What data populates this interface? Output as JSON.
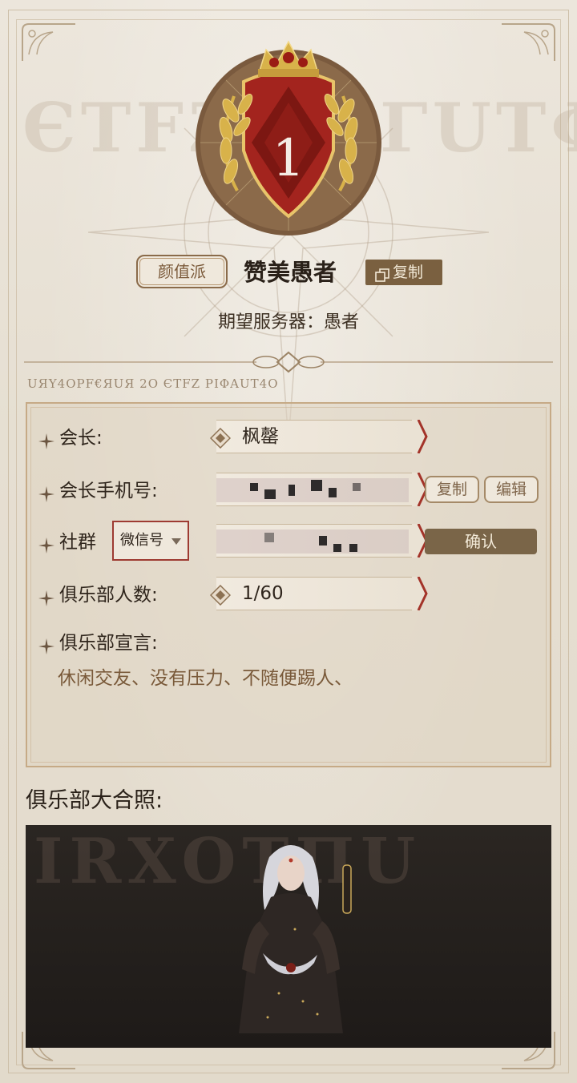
{
  "header": {
    "rank": "1",
    "tag": "颜值派",
    "club_name": "赞美愚者",
    "copy_label": "复制",
    "server_line": "期望服务器：愚者",
    "bg_glyphs_left": "ЄΤFZ",
    "bg_glyphs_right": "ΓUΤΦ",
    "glyph_caption": "UЯΥ4OΡF€ЯUЯ 2O ЄΤFZ ΡΙΦΑUΤ4Ο"
  },
  "info": {
    "leader_label": "会长:",
    "leader_value": "枫罄",
    "phone_label": "会长手机号:",
    "phone_copy_label": "复制",
    "phone_edit_label": "编辑",
    "community_label": "社群",
    "community_type": "微信号",
    "confirm_label": "确认",
    "members_label": "俱乐部人数:",
    "members_value": "1/60",
    "declaration_label": "俱乐部宣言:",
    "declaration_text": "休闲交友、没有压力、不随便踢人、"
  },
  "photo": {
    "title": "俱乐部大合照:",
    "bg_glyphs": "IRXOΤΠU"
  },
  "colors": {
    "accent_brown": "#7a6040",
    "crest_red": "#a3241e",
    "gold": "#d8b24a",
    "panel_border": "#c6aa86"
  },
  "icons": [
    "copy-icon",
    "star-icon",
    "diamond-icon",
    "dropdown-caret-icon",
    "crown-icon",
    "laurel-icon"
  ]
}
